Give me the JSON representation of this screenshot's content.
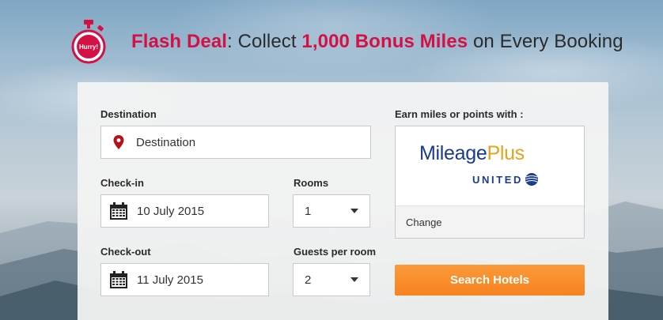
{
  "header": {
    "badge_text": "Hurry!",
    "headline_flash": "Flash Deal",
    "headline_sep": ": Collect ",
    "headline_miles": "1,000 Bonus Miles",
    "headline_tail": " on Every Booking"
  },
  "form": {
    "destination": {
      "label": "Destination",
      "value": "Destination",
      "icon": "map-pin-icon"
    },
    "checkin": {
      "label": "Check-in",
      "value": "10 July 2015",
      "icon": "calendar-icon"
    },
    "checkout": {
      "label": "Check-out",
      "value": "11 July 2015",
      "icon": "calendar-icon"
    },
    "rooms": {
      "label": "Rooms",
      "value": "1"
    },
    "guests": {
      "label": "Guests per room",
      "value": "2"
    },
    "loyalty": {
      "label": "Earn miles or points with :",
      "program_name_1": "Mileage",
      "program_name_2": "Plus",
      "airline": "UNITED",
      "change_label": "Change"
    },
    "search_label": "Search Hotels"
  },
  "colors": {
    "accent_red": "#d31145",
    "button_orange": "#f7831f",
    "united_blue": "#1a3b8f",
    "plus_gold": "#e4a21d"
  }
}
